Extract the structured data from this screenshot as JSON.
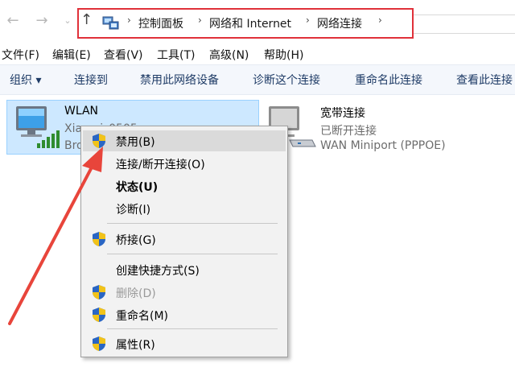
{
  "window": {
    "breadcrumb": [
      "控制面板",
      "网络和 Internet",
      "网络连接"
    ],
    "menu": [
      "文件(F)",
      "编辑(E)",
      "查看(V)",
      "工具(T)",
      "高级(N)",
      "帮助(H)"
    ]
  },
  "toolbar": {
    "organize": "组织 ▾",
    "connect": "连接到",
    "disable": "禁用此网络设备",
    "diagnose": "诊断这个连接",
    "rename": "重命名此连接",
    "status": "查看此连接"
  },
  "connections": [
    {
      "name": "WLAN",
      "line1": "Xiaomi_0505",
      "line2": "Broadcom"
    },
    {
      "name": "宽带连接",
      "line1": "已断开连接",
      "line2": "WAN Miniport (PPPOE)"
    }
  ],
  "context_menu": {
    "items": [
      {
        "label": "禁用(B)",
        "icon": "shield-icon"
      },
      {
        "label": "连接/断开连接(O)"
      },
      {
        "label": "状态(U)"
      },
      {
        "label": "诊断(I)"
      },
      {
        "label": "桥接(G)",
        "icon": "shield-icon"
      },
      {
        "label": "创建快捷方式(S)"
      },
      {
        "label": "删除(D)",
        "icon": "shield-icon"
      },
      {
        "label": "重命名(M)",
        "icon": "shield-icon"
      },
      {
        "label": "属性(R)",
        "icon": "shield-icon"
      }
    ]
  },
  "colors": {
    "highlight_box": "#e0313a",
    "arrow": "#e8453b",
    "selection": "#cde8ff"
  }
}
